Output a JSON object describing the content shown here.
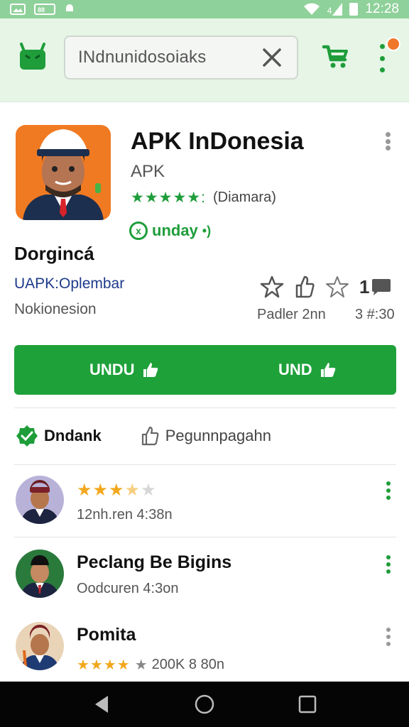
{
  "status_bar": {
    "time": "12:28",
    "left_icons": [
      "image-icon",
      "message-icon",
      "android-icon"
    ],
    "right_icons": [
      "wifi-icon",
      "signal-icon",
      "battery-icon"
    ],
    "signal_text": "4"
  },
  "app_bar": {
    "search_text": "INdnunidosoiaks",
    "colors": {
      "brand_green": "#1e9d3a",
      "bar_bg": "#e6f5e6",
      "notification": "#f0762a"
    }
  },
  "app": {
    "title": "APK InDonesia",
    "developer": "APK",
    "stars": "★★★★★:",
    "rating_count": "(Diamara)",
    "badge_icon_glyph": "x",
    "badge_label": "unday",
    "badge_label_suffix": "•)",
    "name": "Dorgincá",
    "package": "UAPK:Oplembar",
    "subtitle": "Nokionesion",
    "stat_number": "1",
    "stat_label": "Padler 2nn",
    "stat_time": "3 #:30"
  },
  "install": {
    "left_label": "UNDU",
    "right_label": "UND",
    "color": "#1fa13a"
  },
  "actions": {
    "primary_label": "Dndank",
    "secondary_label": "Pegunnpagahn"
  },
  "reviews": [
    {
      "rating": 3.5,
      "meta": "12nh.ren 4:38n"
    },
    {
      "title": "Peclang Be Bigins",
      "meta": "Oodcuren 4:3on"
    },
    {
      "title": "Pomita",
      "meta": "200K 8 80n",
      "rating": 4
    }
  ]
}
